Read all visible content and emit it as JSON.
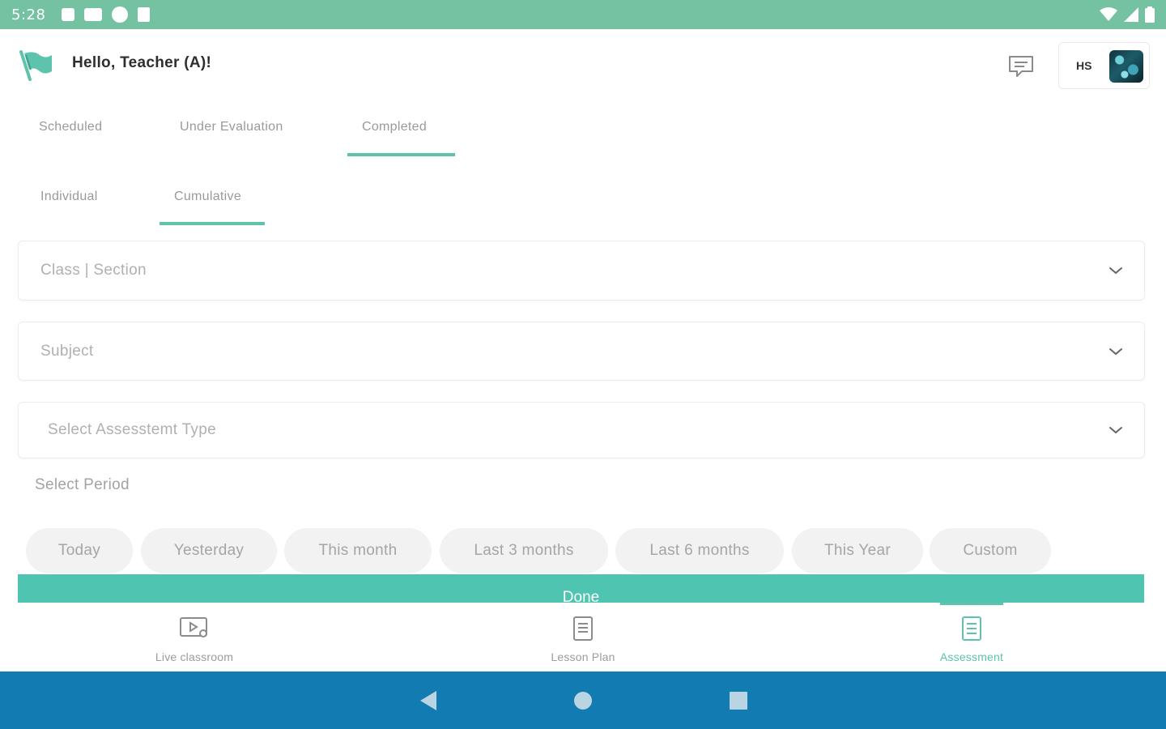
{
  "status_bar": {
    "time": "5:28",
    "background": "#74c2a1"
  },
  "header": {
    "greeting": "Hello, Teacher (A)!",
    "profile_initials": "HS"
  },
  "tabs": [
    {
      "label": "Scheduled",
      "active": false
    },
    {
      "label": "Under Evaluation",
      "active": false
    },
    {
      "label": "Completed",
      "active": true
    }
  ],
  "sub_tabs": [
    {
      "label": "Individual",
      "active": false
    },
    {
      "label": "Cumulative",
      "active": true
    }
  ],
  "filters": {
    "class_section": {
      "placeholder": "Class | Section"
    },
    "subject": {
      "placeholder": "Subject"
    },
    "assessment_type": {
      "placeholder": "Select Assesstemt Type"
    }
  },
  "period": {
    "label": "Select Period",
    "options": [
      "Today",
      "Yesterday",
      "This month",
      "Last 3 months",
      "Last 6 months",
      "This Year",
      "Custom"
    ]
  },
  "done_label": "Done",
  "bottom_nav": [
    {
      "label": "Live classroom",
      "icon": "video-play-icon",
      "active": false
    },
    {
      "label": "Lesson Plan",
      "icon": "document-icon",
      "active": false
    },
    {
      "label": "Assessment",
      "icon": "list-doc-icon",
      "active": true
    }
  ],
  "colors": {
    "accent": "#5ec3ac",
    "done_button": "#4fc4b0",
    "android_nav": "#127bb1"
  }
}
